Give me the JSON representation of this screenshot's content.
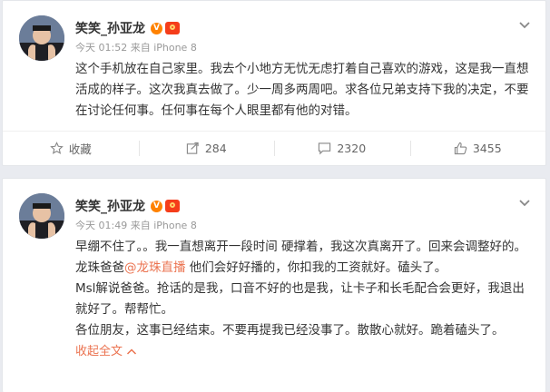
{
  "posts": [
    {
      "username": "笑笑_孙亚龙",
      "verified_badge": "V",
      "timestamp": "今天 01:52",
      "source": "来自 iPhone 8",
      "paragraphs": [
        "这个手机放在自己家里。我去个小地方无忧无虑打着自己喜欢的游戏，这是我一直想活成的样子。这次我真去做了。少一周多两周吧。求各位兄弟支持下我的决定，不要在讨论任何事。任何事在每个人眼里都有他的对错。"
      ],
      "actions": {
        "favorite_label": "收藏",
        "repost_count": "284",
        "comment_count": "2320",
        "like_count": "3455"
      }
    },
    {
      "username": "笑笑_孙亚龙",
      "verified_badge": "V",
      "timestamp": "今天 01:49",
      "source": "来自 iPhone 8",
      "paragraphs": [
        "早绷不住了。。我一直想离开一段时间 硬撑着，我这次真离开了。回来会调整好的。",
        "龙珠爸爸",
        "@龙珠直播",
        " 他们会好好播的，你扣我的工资就好。磕头了。",
        "Msl解说爸爸。抢话的是我，口音不好的也是我，让卡子和长毛配合会更好，我退出就好了。帮帮忙。",
        "各位朋友，这事已经结束。不要再提我已经没事了。散散心就好。跪着磕头了。"
      ],
      "collapse_label": "收起全文"
    }
  ],
  "colors": {
    "accent": "#eb7350",
    "verified": "#ff8200",
    "background": "#e9ebf0"
  },
  "icons": [
    "chevron-down-icon",
    "star-icon",
    "repost-icon",
    "comment-icon",
    "thumbs-up-icon",
    "chevron-up-icon"
  ]
}
